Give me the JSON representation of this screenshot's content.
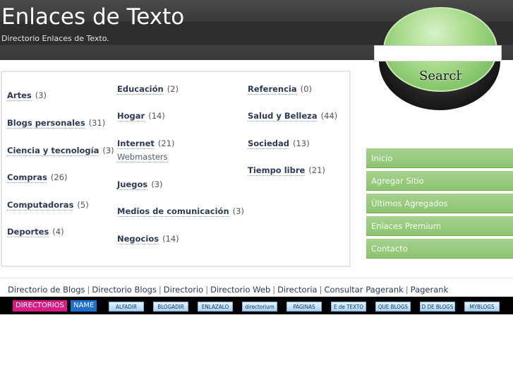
{
  "header": {
    "title": "Enlaces de Texto",
    "subtitle": "Directorio Enlaces de Texto."
  },
  "search": {
    "button_label": "Search",
    "placeholder": ""
  },
  "categories": {
    "col1": [
      {
        "label": "Artes",
        "count": "(3)"
      },
      {
        "label": "Blogs personales",
        "count": "(31)"
      },
      {
        "label": "Ciencia y tecnología",
        "count": "(3)"
      },
      {
        "label": "Compras",
        "count": "(26)"
      },
      {
        "label": "Computadoras",
        "count": "(5)"
      },
      {
        "label": "Deportes",
        "count": "(4)"
      }
    ],
    "col2": [
      {
        "label": "Educación",
        "count": "(2)"
      },
      {
        "label": "Hogar",
        "count": "(14)"
      },
      {
        "label": "Internet",
        "count": "(21)",
        "sub": "Webmasters"
      },
      {
        "label": "Juegos",
        "count": "(3)"
      },
      {
        "label": "Medios de comunicación",
        "count": "(3)"
      },
      {
        "label": "Negocios",
        "count": "(14)"
      }
    ],
    "col3": [
      {
        "label": "Referencia",
        "count": "(0)"
      },
      {
        "label": "Salud y Belleza",
        "count": "(44)"
      },
      {
        "label": "Sociedad",
        "count": "(13)"
      },
      {
        "label": "Tiempo libre",
        "count": "(21)"
      }
    ]
  },
  "nav": [
    "Inicio",
    "Agregar Sitio",
    "Últimos Agregados",
    "Enlaces Premium",
    "Contacto"
  ],
  "footer": {
    "links": [
      "Directorio de Blogs",
      "Directorio Blogs",
      "Directorio",
      "Directorio Web",
      "Directoria",
      "Consultar Pagerank",
      "Pagerank"
    ],
    "separator": "|"
  },
  "banner": {
    "badge1": "DIRECTORIOS",
    "badge2": "NAME",
    "buttons": [
      "ALFADIR",
      "BLOGADIR",
      "ENLAZALO",
      "directorium",
      "PÁGINAS",
      "E de TEXTO",
      "QUE BLOGS",
      "D DE BLOGS",
      "MYBLOGS"
    ]
  },
  "colors": {
    "header_bg": "#2e2e2e",
    "nav_green": "#8dc472",
    "link_color": "#2b3a55",
    "badge_pink": "#d81b84",
    "badge_blue": "#1a6fcf"
  }
}
